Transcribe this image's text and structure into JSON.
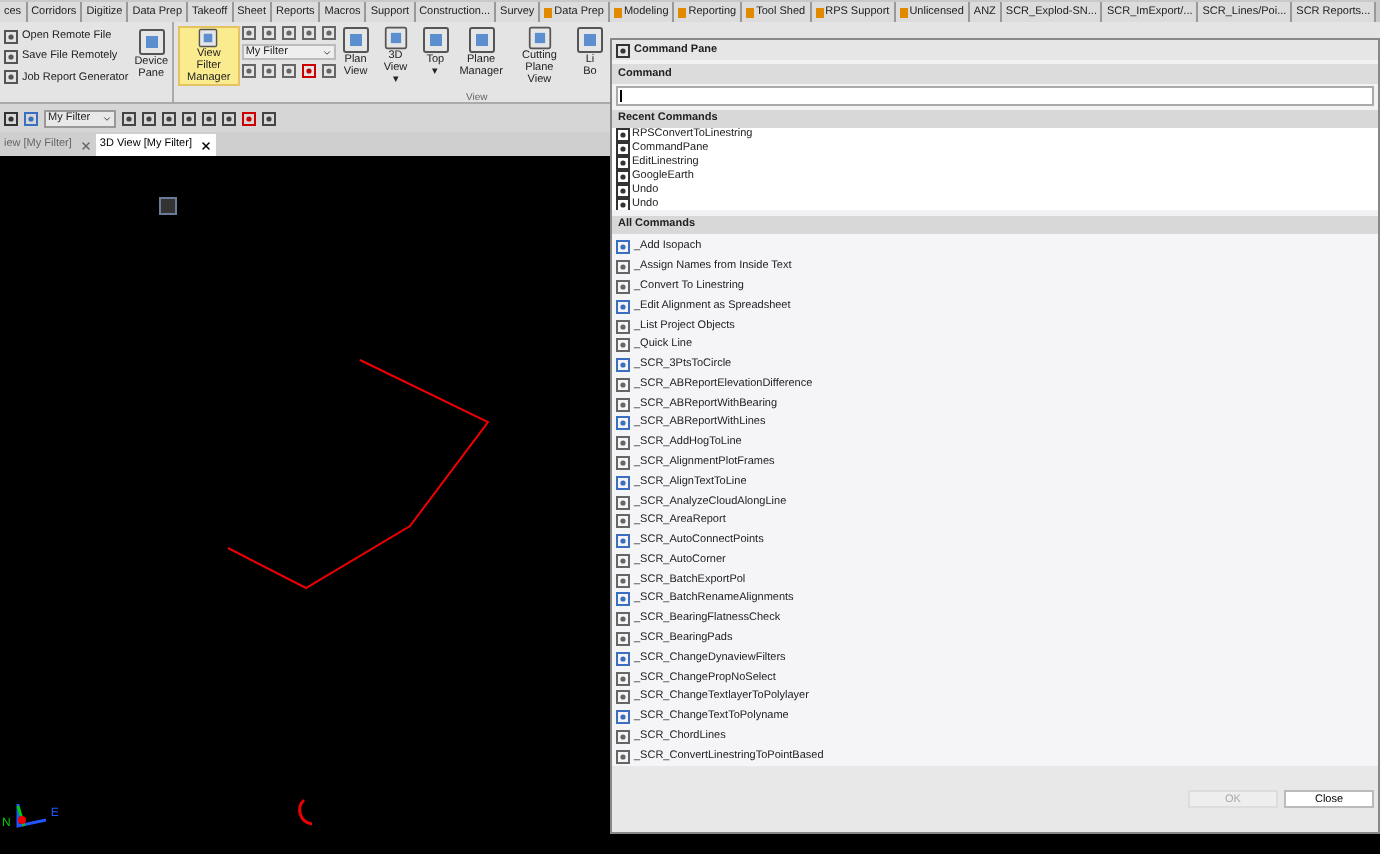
{
  "ribbon_tabs": [
    {
      "label": "ces",
      "kind": "plain"
    },
    {
      "label": "Corridors",
      "kind": "plain"
    },
    {
      "label": "Digitize",
      "kind": "plain"
    },
    {
      "label": "Data Prep",
      "kind": "plain"
    },
    {
      "label": "Takeoff",
      "kind": "plain"
    },
    {
      "label": "Sheet",
      "kind": "plain"
    },
    {
      "label": "Reports",
      "kind": "plain"
    },
    {
      "label": "Macros",
      "kind": "plain"
    },
    {
      "label": "Support",
      "kind": "plain"
    },
    {
      "label": "Construction...",
      "kind": "plain"
    },
    {
      "label": "Survey",
      "kind": "plain"
    },
    {
      "label": "Data Prep",
      "kind": "user"
    },
    {
      "label": "Modeling",
      "kind": "user"
    },
    {
      "label": "Reporting",
      "kind": "user"
    },
    {
      "label": "Tool Shed",
      "kind": "user"
    },
    {
      "label": "RPS Support",
      "kind": "user"
    },
    {
      "label": "Unlicensed",
      "kind": "user"
    },
    {
      "label": "ANZ",
      "kind": "plain"
    },
    {
      "label": "SCR_Explod-SN...",
      "kind": "plain"
    },
    {
      "label": "SCR_ImExport/...",
      "kind": "plain"
    },
    {
      "label": "SCR_Lines/Poi...",
      "kind": "plain"
    },
    {
      "label": "SCR Reports...",
      "kind": "plain"
    }
  ],
  "ribbon": {
    "file_commands": [
      "Open Remote File",
      "Save File Remotely",
      "Job Report Generator"
    ],
    "device_pane": "Device\nPane",
    "view_buttons": [
      {
        "label": "View Filter\nManager",
        "selected": true
      },
      {
        "label": "Plan\nView",
        "selected": false
      },
      {
        "label": "3D\nView ▾",
        "selected": false
      },
      {
        "label": "Top\n▾",
        "selected": false
      },
      {
        "label": "Plane\nManager",
        "selected": false
      },
      {
        "label": "Cutting\nPlane View",
        "selected": false
      },
      {
        "label": "Li\nBo",
        "selected": false
      }
    ],
    "filter_select": "My Filter",
    "group_label": "View"
  },
  "toolbar": {
    "filter_select": "My Filter"
  },
  "document_tabs": [
    {
      "label": "iew [My Filter]",
      "selected": false
    },
    {
      "label": "3D View [My Filter]",
      "selected": true
    }
  ],
  "viewport": {
    "compass": {
      "north": "N",
      "east": "E"
    }
  },
  "command_pane": {
    "title": "Command Pane",
    "command_label": "Command",
    "recent_header": "Recent Commands",
    "recent": [
      "RPSConvertToLinestring",
      "CommandPane",
      "EditLinestring",
      "GoogleEarth",
      "Undo",
      "Undo"
    ],
    "all_header": "All Commands",
    "all": [
      "_Add Isopach",
      "_Assign Names from Inside Text",
      "_Convert To Linestring",
      "_Edit Alignment as Spreadsheet",
      "_List Project Objects",
      "_Quick Line",
      "_SCR_3PtsToCircle",
      "_SCR_ABReportElevationDifference",
      "_SCR_ABReportWithBearing",
      "_SCR_ABReportWithLines",
      "_SCR_AddHogToLine",
      "_SCR_AlignmentPlotFrames",
      "_SCR_AlignTextToLine",
      "_SCR_AnalyzeCloudAlongLine",
      "_SCR_AreaReport",
      "_SCR_AutoConnectPoints",
      "_SCR_AutoCorner",
      "_SCR_BatchExportPol",
      "_SCR_BatchRenameAlignments",
      "_SCR_BearingFlatnessCheck",
      "_SCR_BearingPads",
      "_SCR_ChangeDynaviewFilters",
      "_SCR_ChangePropNoSelect",
      "_SCR_ChangeTextlayerToPolylayer",
      "_SCR_ChangeTextToPolyname",
      "_SCR_ChordLines",
      "_SCR_ConvertLinestringToPointBased"
    ],
    "buttons": [
      {
        "label": "OK",
        "disabled": true
      },
      {
        "label": "Close",
        "disabled": false
      }
    ]
  }
}
